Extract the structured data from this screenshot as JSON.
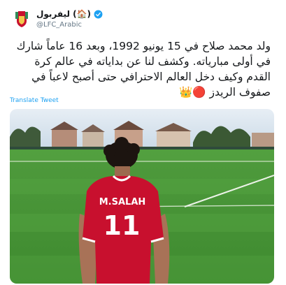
{
  "account": {
    "display_name": "ليفربول (🏠)",
    "handle": "@LFC_Arabic",
    "verified": true,
    "avatar_icon": "lfc-crest-icon"
  },
  "tweet": {
    "text": "ولد محمد صلاح في 15 يونيو 1992، وبعد 16 عاماً شارك في أولى مبارياته. وكشف لنا عن بداياته في عالم كرة القدم وكيف دخل العالم الاحترافي حتى أصبح لاعباً في صفوف الريدز 🔴👑",
    "translate_link": "Translate Tweet"
  },
  "media": {
    "shirt_name": "M.SALAH",
    "shirt_number": "11",
    "colors": {
      "shirt": "#c8102e",
      "pitch": "#4c9a3a",
      "sky": "#cfe0ee"
    }
  }
}
